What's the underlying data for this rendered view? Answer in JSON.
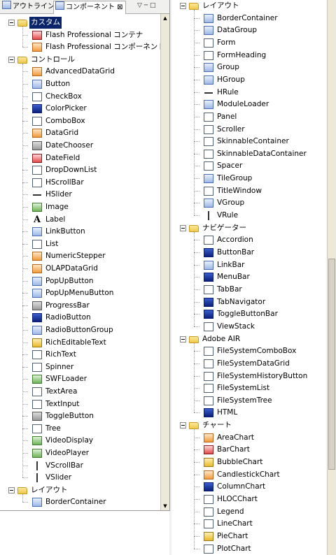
{
  "left": {
    "tabs": [
      {
        "label": "アウトライン",
        "icon": "outline-icon"
      },
      {
        "label": "コンポーネント ⊠",
        "icon": "components-icon"
      }
    ],
    "view_menu": "▽ ─ □",
    "items": [
      {
        "depth": 0,
        "toggle": true,
        "icon": "folder",
        "label": "カスタム",
        "selected": true
      },
      {
        "depth": 1,
        "icon": "g",
        "label": "Flash Professional コンテナ"
      },
      {
        "depth": 1,
        "icon": "b",
        "label": "Flash Professional コンポーネント"
      },
      {
        "depth": 0,
        "toggle": true,
        "icon": "folder",
        "label": "コントロール"
      },
      {
        "depth": 1,
        "icon": "b",
        "label": "AdvancedDataGrid"
      },
      {
        "depth": 1,
        "icon": "a",
        "label": "Button"
      },
      {
        "depth": 1,
        "icon": "c",
        "label": "CheckBox"
      },
      {
        "depth": 1,
        "icon": "f",
        "label": "ColorPicker"
      },
      {
        "depth": 1,
        "icon": "c",
        "label": "ComboBox"
      },
      {
        "depth": 1,
        "icon": "b",
        "label": "DataGrid"
      },
      {
        "depth": 1,
        "icon": "e",
        "label": "DateChooser"
      },
      {
        "depth": 1,
        "icon": "g",
        "label": "DateField"
      },
      {
        "depth": 1,
        "icon": "c",
        "label": "DropDownList"
      },
      {
        "depth": 1,
        "icon": "c",
        "label": "HScrollBar"
      },
      {
        "depth": 1,
        "icon": "line",
        "label": "HSlider"
      },
      {
        "depth": 1,
        "icon": "d",
        "label": "Image"
      },
      {
        "depth": 1,
        "icon": "t",
        "label": "Label"
      },
      {
        "depth": 1,
        "icon": "a",
        "label": "LinkButton"
      },
      {
        "depth": 1,
        "icon": "c",
        "label": "List"
      },
      {
        "depth": 1,
        "icon": "b",
        "label": "NumericStepper"
      },
      {
        "depth": 1,
        "icon": "b",
        "label": "OLAPDataGrid"
      },
      {
        "depth": 1,
        "icon": "a",
        "label": "PopUpButton"
      },
      {
        "depth": 1,
        "icon": "a",
        "label": "PopUpMenuButton"
      },
      {
        "depth": 1,
        "icon": "e",
        "label": "ProgressBar"
      },
      {
        "depth": 1,
        "icon": "f",
        "label": "RadioButton"
      },
      {
        "depth": 1,
        "icon": "a",
        "label": "RadioButtonGroup"
      },
      {
        "depth": 1,
        "icon": "h",
        "label": "RichEditableText"
      },
      {
        "depth": 1,
        "icon": "c",
        "label": "RichText"
      },
      {
        "depth": 1,
        "icon": "c",
        "label": "Spinner"
      },
      {
        "depth": 1,
        "icon": "d",
        "label": "SWFLoader"
      },
      {
        "depth": 1,
        "icon": "c",
        "label": "TextArea"
      },
      {
        "depth": 1,
        "icon": "c",
        "label": "TextInput"
      },
      {
        "depth": 1,
        "icon": "e",
        "label": "ToggleButton"
      },
      {
        "depth": 1,
        "icon": "c",
        "label": "Tree"
      },
      {
        "depth": 1,
        "icon": "d",
        "label": "VideoDisplay"
      },
      {
        "depth": 1,
        "icon": "d",
        "label": "VideoPlayer"
      },
      {
        "depth": 1,
        "icon": "vline",
        "label": "VScrollBar"
      },
      {
        "depth": 1,
        "icon": "vline",
        "label": "VSlider"
      },
      {
        "depth": 0,
        "toggle": true,
        "icon": "folder",
        "label": "レイアウト"
      },
      {
        "depth": 1,
        "icon": "a",
        "label": "BorderContainer"
      }
    ]
  },
  "right": {
    "items": [
      {
        "depth": 0,
        "toggle": true,
        "icon": "folder",
        "label": "レイアウト"
      },
      {
        "depth": 1,
        "icon": "a",
        "label": "BorderContainer"
      },
      {
        "depth": 1,
        "icon": "a",
        "label": "DataGroup"
      },
      {
        "depth": 1,
        "icon": "c",
        "label": "Form"
      },
      {
        "depth": 1,
        "icon": "c",
        "label": "FormHeading"
      },
      {
        "depth": 1,
        "icon": "a",
        "label": "Group"
      },
      {
        "depth": 1,
        "icon": "a",
        "label": "HGroup"
      },
      {
        "depth": 1,
        "icon": "line",
        "label": "HRule"
      },
      {
        "depth": 1,
        "icon": "a",
        "label": "ModuleLoader"
      },
      {
        "depth": 1,
        "icon": "c",
        "label": "Panel"
      },
      {
        "depth": 1,
        "icon": "c",
        "label": "Scroller"
      },
      {
        "depth": 1,
        "icon": "c",
        "label": "SkinnableContainer"
      },
      {
        "depth": 1,
        "icon": "c",
        "label": "SkinnableDataContainer"
      },
      {
        "depth": 1,
        "icon": "c",
        "label": "Spacer"
      },
      {
        "depth": 1,
        "icon": "a",
        "label": "TileGroup"
      },
      {
        "depth": 1,
        "icon": "c",
        "label": "TitleWindow"
      },
      {
        "depth": 1,
        "icon": "a",
        "label": "VGroup"
      },
      {
        "depth": 1,
        "icon": "vline",
        "label": "VRule"
      },
      {
        "depth": 0,
        "toggle": true,
        "icon": "folder",
        "label": "ナビゲーター"
      },
      {
        "depth": 1,
        "icon": "c",
        "label": "Accordion"
      },
      {
        "depth": 1,
        "icon": "f",
        "label": "ButtonBar"
      },
      {
        "depth": 1,
        "icon": "a",
        "label": "LinkBar"
      },
      {
        "depth": 1,
        "icon": "f",
        "label": "MenuBar"
      },
      {
        "depth": 1,
        "icon": "c",
        "label": "TabBar"
      },
      {
        "depth": 1,
        "icon": "f",
        "label": "TabNavigator"
      },
      {
        "depth": 1,
        "icon": "f",
        "label": "ToggleButtonBar"
      },
      {
        "depth": 1,
        "icon": "c",
        "label": "ViewStack"
      },
      {
        "depth": 0,
        "toggle": true,
        "icon": "folder",
        "label": "Adobe AIR"
      },
      {
        "depth": 1,
        "icon": "c",
        "label": "FileSystemComboBox"
      },
      {
        "depth": 1,
        "icon": "c",
        "label": "FileSystemDataGrid"
      },
      {
        "depth": 1,
        "icon": "c",
        "label": "FileSystemHistoryButton"
      },
      {
        "depth": 1,
        "icon": "c",
        "label": "FileSystemList"
      },
      {
        "depth": 1,
        "icon": "c",
        "label": "FileSystemTree"
      },
      {
        "depth": 1,
        "icon": "f",
        "label": "HTML"
      },
      {
        "depth": 0,
        "toggle": true,
        "icon": "folder",
        "label": "チャート"
      },
      {
        "depth": 1,
        "icon": "b",
        "label": "AreaChart"
      },
      {
        "depth": 1,
        "icon": "g",
        "label": "BarChart"
      },
      {
        "depth": 1,
        "icon": "h",
        "label": "BubbleChart"
      },
      {
        "depth": 1,
        "icon": "b",
        "label": "CandlestickChart"
      },
      {
        "depth": 1,
        "icon": "f",
        "label": "ColumnChart"
      },
      {
        "depth": 1,
        "icon": "c",
        "label": "HLOCChart"
      },
      {
        "depth": 1,
        "icon": "c",
        "label": "Legend"
      },
      {
        "depth": 1,
        "icon": "c",
        "label": "LineChart"
      },
      {
        "depth": 1,
        "icon": "h",
        "label": "PieChart"
      },
      {
        "depth": 1,
        "icon": "c",
        "label": "PlotChart"
      }
    ]
  }
}
